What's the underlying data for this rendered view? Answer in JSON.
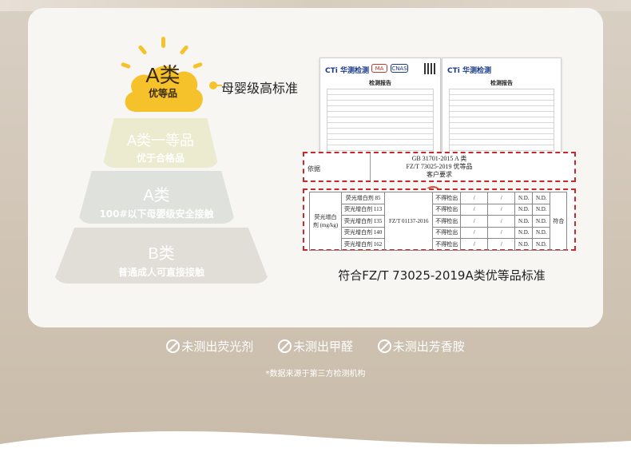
{
  "pyramid": {
    "top": {
      "grade": "A类",
      "label": "优等品"
    },
    "pointer_text": "母婴级高标准",
    "tier2": {
      "grade": "A类一等品",
      "label": "优于合格品"
    },
    "tier3": {
      "grade": "A类",
      "label": "100#以下母婴级安全接触"
    },
    "tier4": {
      "grade": "B类",
      "label": "普通成人可直接接触"
    }
  },
  "report": {
    "logo": "CTi 华测检测",
    "title": "检测报告",
    "cert_badges": [
      "MA",
      "CNAS"
    ],
    "standard_box": {
      "label": "依据",
      "lines": [
        "GB 31701-2015 A 类",
        "FZ/T 73025-2019 优等品",
        "客户要求"
      ]
    },
    "results_box": {
      "category": "荧光增白剂 (mg/kg)",
      "method": "FZ/T 01137-2016",
      "conclusion": "符合",
      "rows": [
        {
          "item": "荧光增白剂 85",
          "req": "不得检出",
          "a": "/",
          "b": "/",
          "c": "N.D.",
          "d": "N.D."
        },
        {
          "item": "荧光增白剂 113",
          "req": "不得检出",
          "a": "/",
          "b": "/",
          "c": "N.D.",
          "d": "N.D."
        },
        {
          "item": "荧光增白剂 135",
          "req": "不得检出",
          "a": "/",
          "b": "/",
          "c": "N.D.",
          "d": "N.D."
        },
        {
          "item": "荧光增白剂 140",
          "req": "不得检出",
          "a": "/",
          "b": "/",
          "c": "N.D.",
          "d": "N.D."
        },
        {
          "item": "荧光增白剂 162",
          "req": "不得检出",
          "a": "/",
          "b": "/",
          "c": "N.D.",
          "d": "N.D."
        }
      ]
    },
    "caption": "符合FZ/T 73025-2019A类优等品标准"
  },
  "claims": [
    "未测出荧光剂",
    "未测出甲醛",
    "未测出芳香胺"
  ],
  "note": "*数据来源于第三方检测机构",
  "colors": {
    "accent": "#f6c22b",
    "dashed_red": "#c6282b",
    "background": "#d0c5b6"
  },
  "icons": [
    "ban-icon"
  ]
}
